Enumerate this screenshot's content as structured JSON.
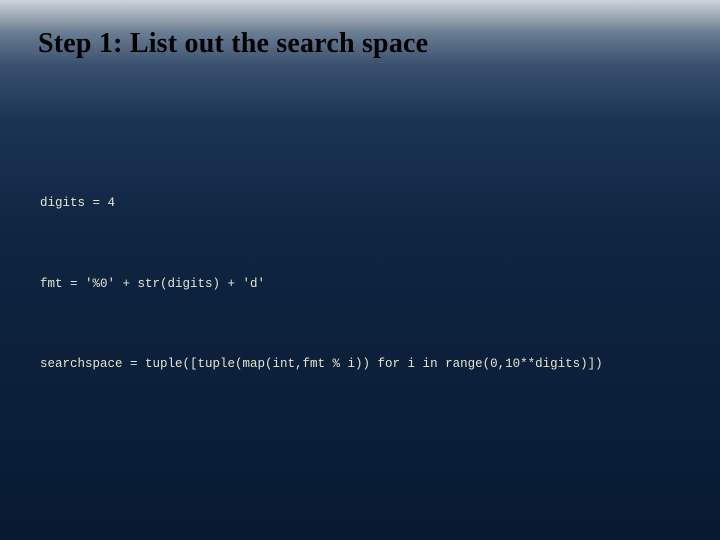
{
  "title": "Step 1:  List out the search space",
  "code": {
    "line1": "digits = 4",
    "line2": "fmt = '%0' + str(digits) + 'd'",
    "line3": "searchspace = tuple([tuple(map(int,fmt % i)) for i in range(0,10**digits)])"
  }
}
